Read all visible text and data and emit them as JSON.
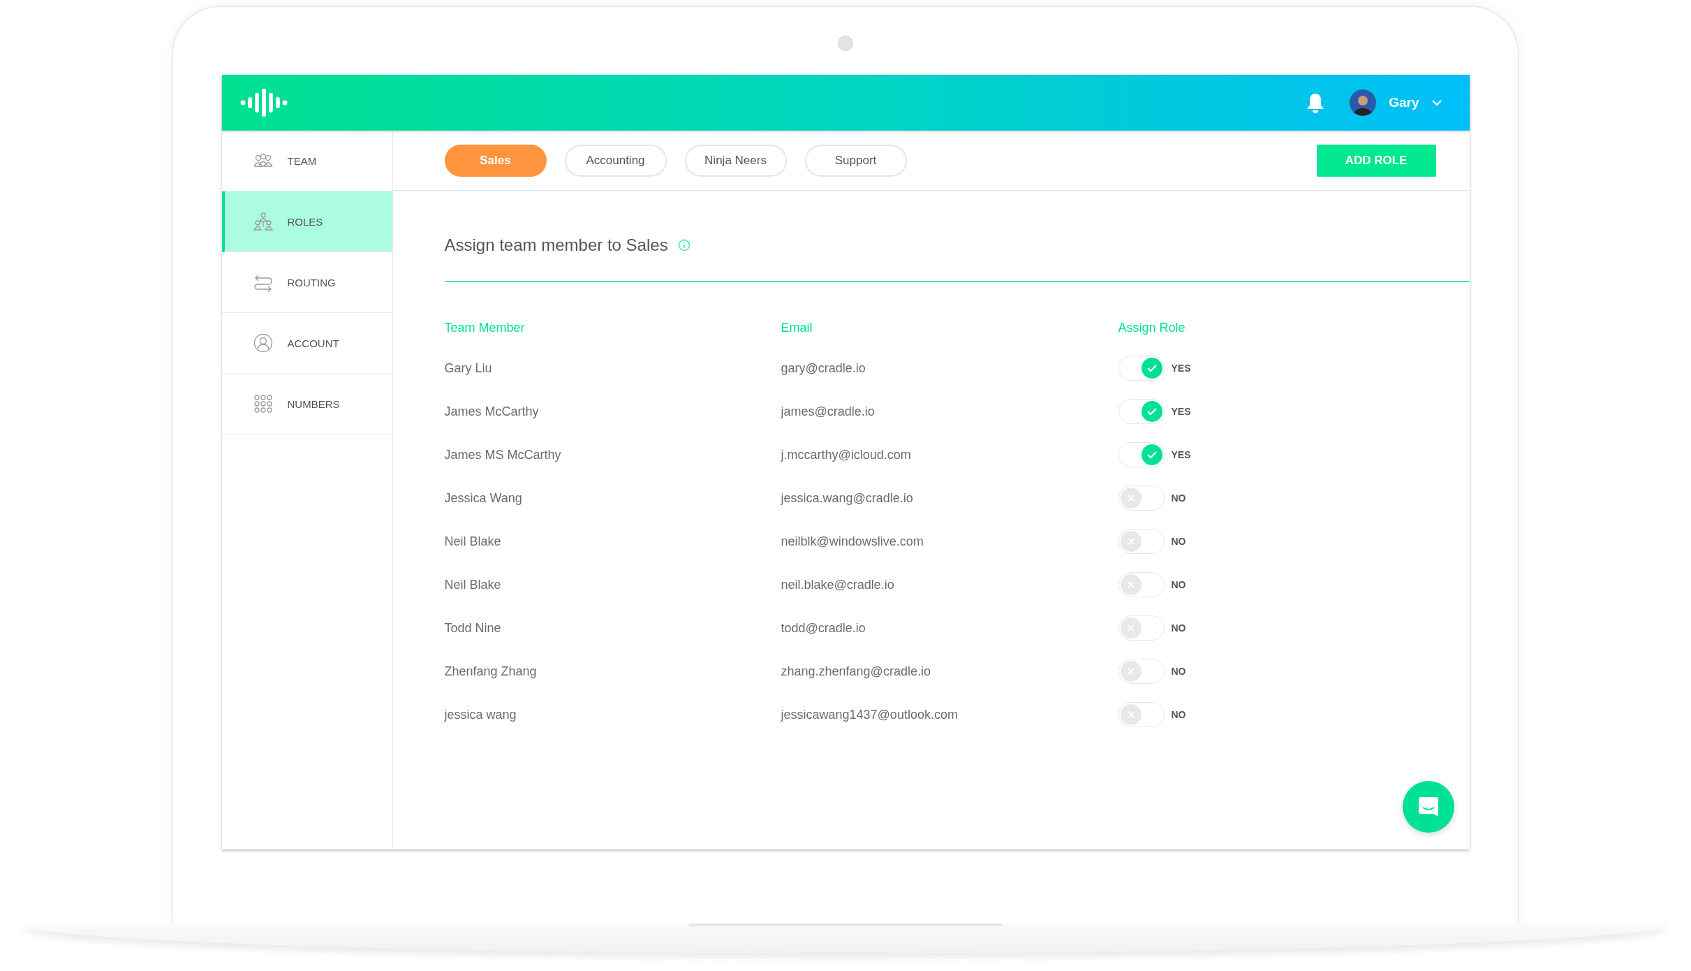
{
  "header": {
    "user": {
      "name": "Gary"
    }
  },
  "sidebar": {
    "items": [
      {
        "label": "TEAM",
        "kind": "team",
        "selected": false
      },
      {
        "label": "ROLES",
        "kind": "roles",
        "selected": true
      },
      {
        "label": "ROUTING",
        "kind": "routing",
        "selected": false
      },
      {
        "label": "ACCOUNT",
        "kind": "account",
        "selected": false
      },
      {
        "label": "NUMBERS",
        "kind": "numbers",
        "selected": false
      }
    ]
  },
  "tabs": [
    {
      "label": "Sales",
      "selected": true
    },
    {
      "label": "Accounting",
      "selected": false
    },
    {
      "label": "Ninja Neers",
      "selected": false
    },
    {
      "label": "Support",
      "selected": false
    }
  ],
  "add_role_button": "ADD ROLE",
  "panel": {
    "title": "Assign team member to Sales"
  },
  "table": {
    "columns": [
      "Team Member",
      "Email",
      "Assign Role"
    ],
    "rows": [
      {
        "name": "Gary Liu",
        "email": "gary@cradle.io",
        "assigned": true,
        "status": "YES"
      },
      {
        "name": "James McCarthy",
        "email": "james@cradle.io",
        "assigned": true,
        "status": "YES"
      },
      {
        "name": "James MS McCarthy",
        "email": "j.mccarthy@icloud.com",
        "assigned": true,
        "status": "YES"
      },
      {
        "name": "Jessica Wang",
        "email": "jessica.wang@cradle.io",
        "assigned": false,
        "status": "NO"
      },
      {
        "name": "Neil Blake",
        "email": "neilblk@windowslive.com",
        "assigned": false,
        "status": "NO"
      },
      {
        "name": "Neil Blake",
        "email": "neil.blake@cradle.io",
        "assigned": false,
        "status": "NO"
      },
      {
        "name": "Todd Nine",
        "email": "todd@cradle.io",
        "assigned": false,
        "status": "NO"
      },
      {
        "name": "Zhenfang Zhang",
        "email": "zhang.zhenfang@cradle.io",
        "assigned": false,
        "status": "NO"
      },
      {
        "name": "jessica wang",
        "email": "jessicawang1437@outlook.com",
        "assigned": false,
        "status": "NO"
      }
    ]
  }
}
